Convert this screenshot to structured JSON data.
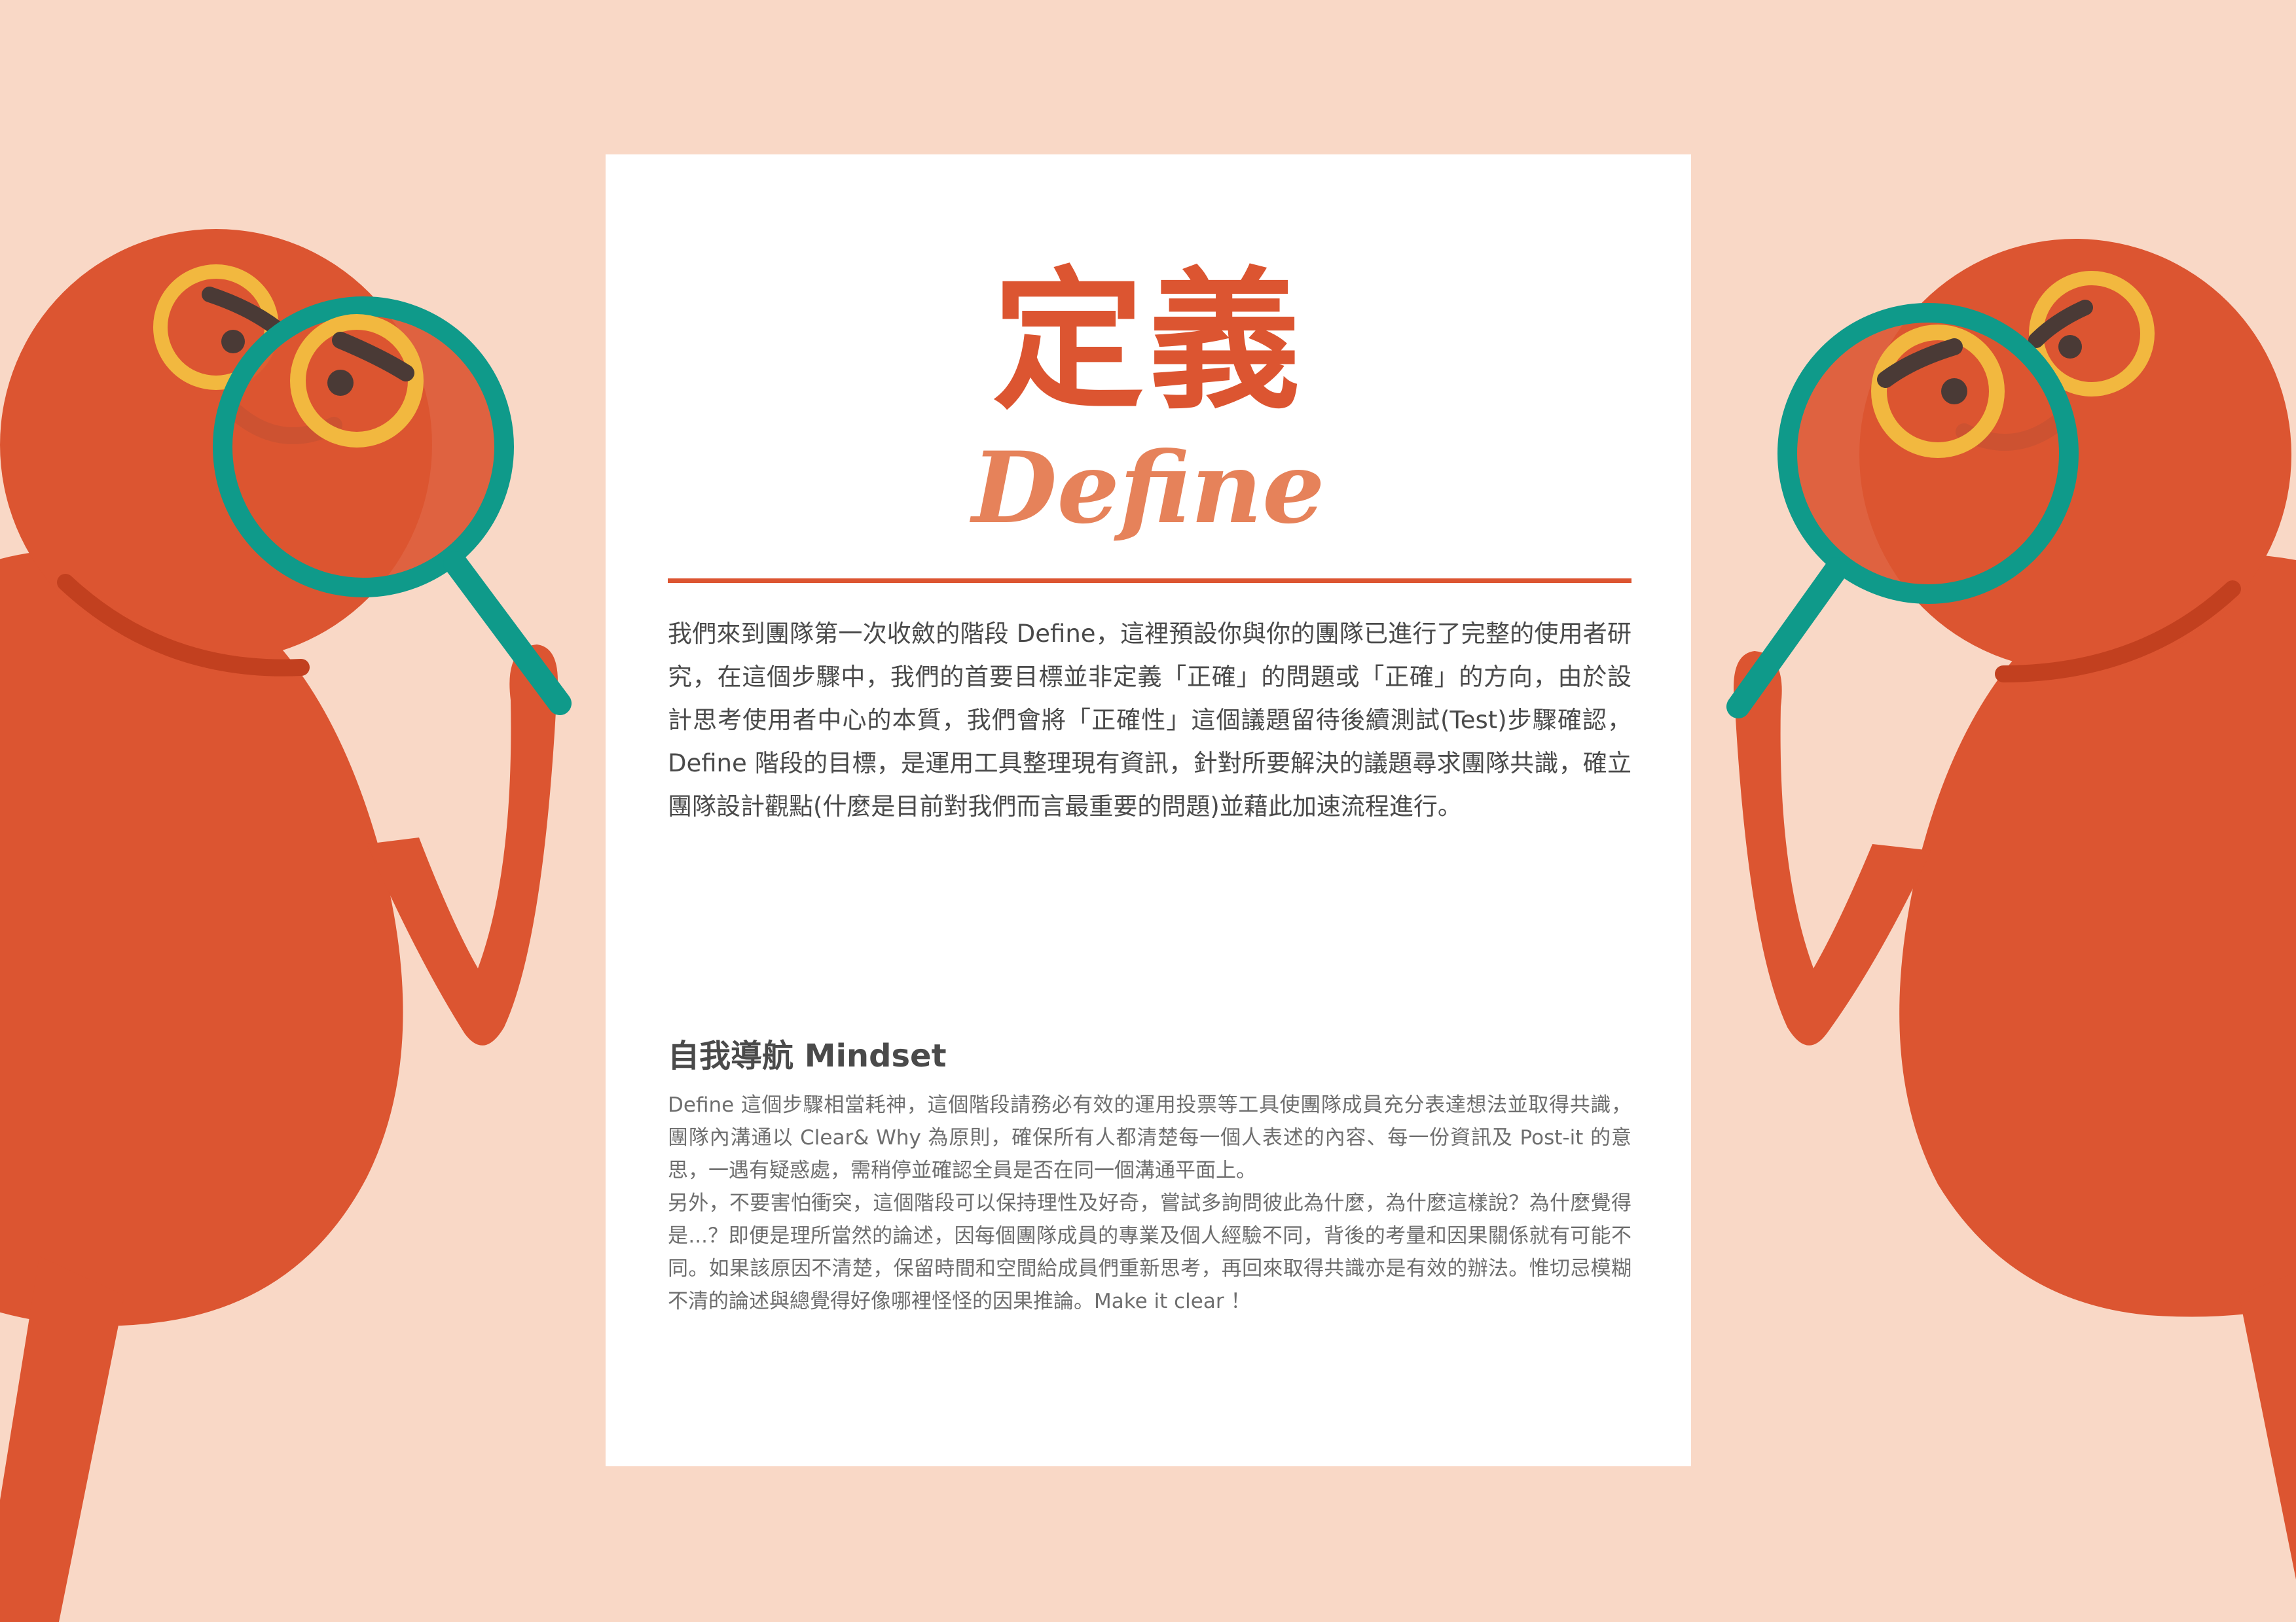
{
  "title": {
    "chinese": "定義",
    "english": "Define"
  },
  "intro": "我們來到團隊第一次收斂的階段 Define，這裡預設你與你的團隊已進行了完整的使用者研究，在這個步驟中，我們的首要目標並非定義「正確」的問題或「正確」的方向，由於設計思考使用者中心的本質，我們會將「正確性」這個議題留待後續測試(Test)步驟確認，Define 階段的目標，是運用工具整理現有資訊，針對所要解決的議題尋求團隊共識，確立團隊設計觀點(什麼是目前對我們而言最重要的問題)並藉此加速流程進行。",
  "mindset": {
    "heading": "自我導航 Mindset",
    "paragraph1": "Define 這個步驟相當耗神，這個階段請務必有效的運用投票等工具使團隊成員充分表達想法並取得共識，團隊內溝通以 Clear& Why 為原則，確保所有人都清楚每一個人表述的內容、每一份資訊及 Post-it 的意思，一遇有疑惑處，需稍停並確認全員是否在同一個溝通平面上。",
    "paragraph2": "另外，不要害怕衝突，這個階段可以保持理性及好奇，嘗試多詢問彼此為什麼，為什麼這樣說？為什麼覺得是...？即便是理所當然的論述，因每個團隊成員的專業及個人經驗不同，背後的考量和因果關係就有可能不同。如果該原因不清楚，保留時間和空間給成員們重新思考，再回來取得共識亦是有效的辦法。惟切忌模糊不清的論述與總覺得好像哪裡怪怪的因果推論。Make it clear ！"
  },
  "colors": {
    "background": "#f9d8c6",
    "character": "#dc5531",
    "magnifier": "#0f9a8a",
    "glasses": "#f2b83f",
    "eyes": "#4a3a36",
    "accent": "#dc5531"
  }
}
